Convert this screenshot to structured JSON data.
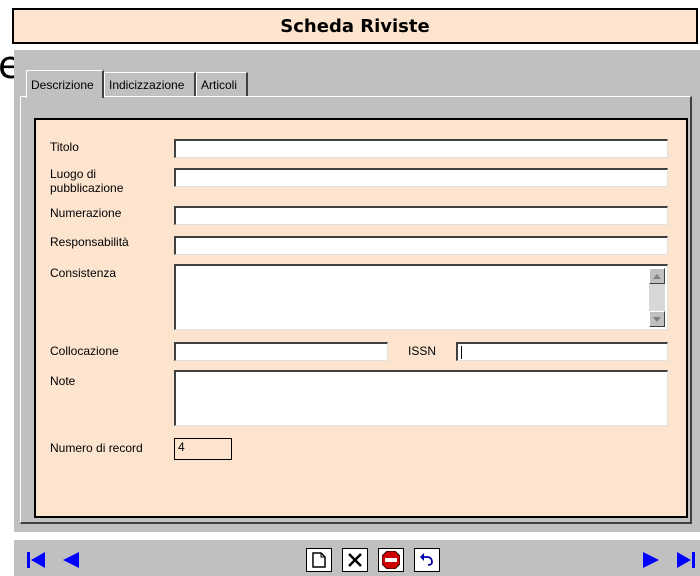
{
  "window": {
    "title": "Scheda Riviste",
    "stray_char": "e"
  },
  "tabs": [
    {
      "label": "Descrizione",
      "active": true
    },
    {
      "label": "Indicizzazione",
      "active": false
    },
    {
      "label": "Articoli",
      "active": false
    }
  ],
  "form": {
    "titolo": {
      "label": "Titolo",
      "value": ""
    },
    "luogo": {
      "label_line1": "Luogo di",
      "label_line2": "pubblicazione",
      "value": ""
    },
    "numerazione": {
      "label": "Numerazione",
      "value": ""
    },
    "responsabilita": {
      "label": "Responsabilità",
      "value": ""
    },
    "consistenza": {
      "label": "Consistenza",
      "value": ""
    },
    "collocazione": {
      "label": "Collocazione",
      "value": ""
    },
    "issn": {
      "label": "ISSN",
      "value": ""
    },
    "note": {
      "label": "Note",
      "value": ""
    },
    "numero_record": {
      "label": "Numero di record",
      "value": "4"
    }
  },
  "navigation": {
    "buttons": [
      "first-record",
      "previous-record",
      "new-record",
      "delete-record",
      "stop",
      "undo",
      "next-record",
      "last-record"
    ]
  },
  "colors": {
    "form_background": "#fce4cf",
    "panel": "#c0c0c0",
    "nav_arrows": "#0000ff",
    "stop_red": "#cc0000"
  }
}
